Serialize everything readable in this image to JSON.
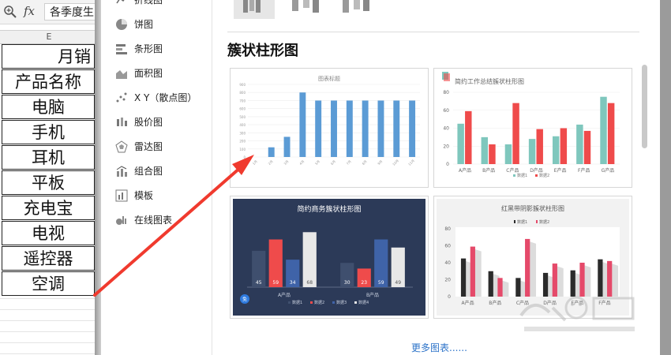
{
  "formula_bar": {
    "fx_label": "fx",
    "cell_value": "各季度生"
  },
  "sheet": {
    "column_header": "E",
    "merged_title": "月销",
    "rows": [
      "产品名称",
      "电脑",
      "手机",
      "耳机",
      "平板",
      "充电宝",
      "电视",
      "遥控器",
      "空调"
    ]
  },
  "sidebar": {
    "items": [
      {
        "label": "折线图",
        "icon": "line-chart-icon"
      },
      {
        "label": "饼图",
        "icon": "pie-chart-icon"
      },
      {
        "label": "条形图",
        "icon": "bar-chart-icon"
      },
      {
        "label": "面积图",
        "icon": "area-chart-icon"
      },
      {
        "label": "X Y（散点图）",
        "icon": "scatter-chart-icon"
      },
      {
        "label": "股价图",
        "icon": "stock-chart-icon"
      },
      {
        "label": "雷达图",
        "icon": "radar-chart-icon"
      },
      {
        "label": "组合图",
        "icon": "combo-chart-icon"
      },
      {
        "label": "模板",
        "icon": "template-icon"
      },
      {
        "label": "在线图表",
        "icon": "online-chart-icon"
      }
    ]
  },
  "section_title": "簇状柱形图",
  "more_link": "更多图表......",
  "templates": [
    {
      "title": "图表标题",
      "chart_data": {
        "type": "bar",
        "categories": [
          "1月",
          "2月",
          "3月",
          "4月",
          "5月",
          "6月",
          "7月",
          "8月",
          "9月",
          "10月",
          "11月"
        ],
        "values": [
          0,
          120,
          250,
          800,
          700,
          700,
          700,
          700,
          700,
          700,
          700
        ],
        "yticks": [
          "900",
          "800",
          "700",
          "600",
          "500",
          "400",
          "300",
          "200",
          "100",
          "0"
        ],
        "color": "#5b9bd5"
      }
    },
    {
      "title": "简约工作总结簇状柱形图",
      "chart_data": {
        "type": "bar",
        "categories": [
          "A产品",
          "B产品",
          "C产品",
          "D产品",
          "E产品",
          "F产品",
          "G产品"
        ],
        "yticks": [
          "80",
          "60",
          "40",
          "20",
          "0"
        ],
        "ylim": [
          0,
          80
        ],
        "legend": [
          "数据1",
          "数据2"
        ],
        "series": [
          {
            "values": [
              45,
              30,
              22,
              28,
              31,
              44,
              75
            ],
            "color": "#7fc7bd"
          },
          {
            "values": [
              59,
              22,
              68,
              39,
              40,
              37,
              68
            ],
            "color": "#ef4b4b"
          }
        ]
      }
    },
    {
      "title": "简约商务簇状柱形图",
      "chart_data": {
        "type": "bar",
        "categories": [
          "A产品",
          "B产品"
        ],
        "legend": [
          "数据1",
          "数据2",
          "数据3",
          "数据4"
        ],
        "series": [
          {
            "values": [
              45,
              30
            ],
            "color": "#3f4f6e"
          },
          {
            "values": [
              59,
              23
            ],
            "color": "#ef4b4b"
          },
          {
            "values": [
              34,
              59
            ],
            "color": "#3f63a8"
          },
          {
            "values": [
              68,
              49
            ],
            "color": "#e8e8e8"
          }
        ],
        "badge": "免"
      }
    },
    {
      "title": "红黑带阴影簇状柱形图",
      "chart_data": {
        "type": "bar",
        "categories": [
          "A产品",
          "B产品",
          "C产品",
          "D产品",
          "E产品",
          "F产品"
        ],
        "yticks": [
          "80",
          "60",
          "40",
          "20",
          "0"
        ],
        "ylim": [
          0,
          80
        ],
        "legend": [
          "数据1",
          "数据2"
        ],
        "series": [
          {
            "values": [
              45,
              30,
              22,
              28,
              31,
              44
            ],
            "color": "#2b2b2b"
          },
          {
            "values": [
              59,
              22,
              68,
              39,
              40,
              42
            ],
            "color": "#e54a6a"
          }
        ]
      }
    }
  ]
}
